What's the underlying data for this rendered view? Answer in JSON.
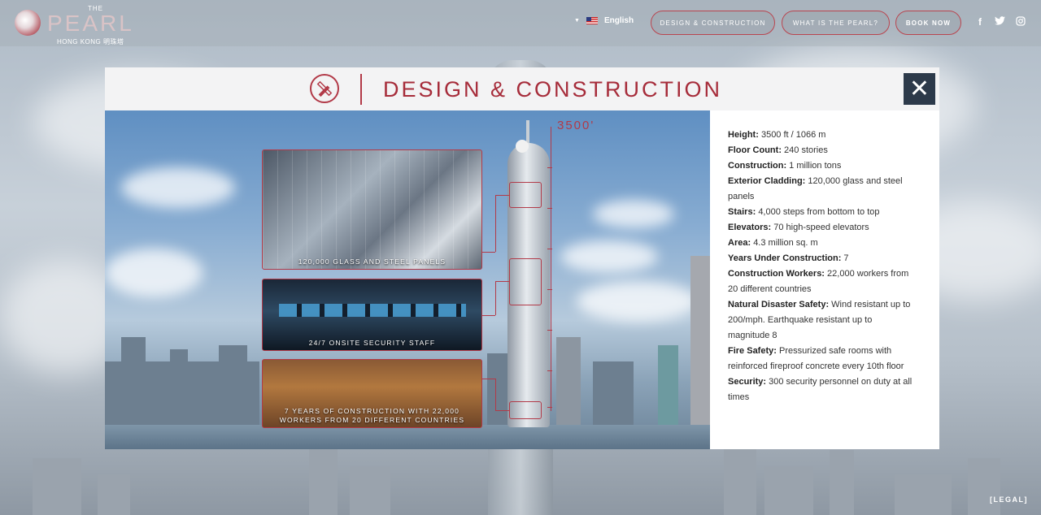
{
  "header": {
    "logo": {
      "the": "THE",
      "pearl": "PEARL",
      "subtitle": "HONG KONG 明珠塔"
    },
    "language": {
      "label": "English"
    },
    "nav": [
      {
        "label": "DESIGN & CONSTRUCTION"
      },
      {
        "label": "WHAT IS THE PEARL?"
      },
      {
        "label": "BOOK NOW"
      }
    ],
    "social": [
      "facebook-icon",
      "twitter-icon",
      "instagram-icon"
    ]
  },
  "modal": {
    "title": "DESIGN & CONSTRUCTION",
    "close_label": "✕",
    "height_label": "3500'",
    "panels": [
      {
        "caption": "120,000 GLASS AND STEEL PANELS"
      },
      {
        "caption": "24/7 ONSITE SECURITY STAFF"
      },
      {
        "caption": "7 YEARS OF CONSTRUCTION WITH 22,000 WORKERS FROM 20 DIFFERENT COUNTRIES"
      }
    ],
    "facts": [
      {
        "label": "Height:",
        "value": "3500 ft / 1066 m"
      },
      {
        "label": "Floor Count:",
        "value": "240 stories"
      },
      {
        "label": "Construction:",
        "value": "1 million tons"
      },
      {
        "label": "Exterior Cladding:",
        "value": "120,000 glass and steel panels"
      },
      {
        "label": "Stairs:",
        "value": "4,000 steps from bottom to top"
      },
      {
        "label": "Elevators:",
        "value": "70 high-speed elevators"
      },
      {
        "label": "Area:",
        "value": "4.3 million sq. m"
      },
      {
        "label": "Years Under Construction:",
        "value": "7"
      },
      {
        "label": "Construction Workers:",
        "value": "22,000 workers from 20 different countries"
      },
      {
        "label": "Natural Disaster Safety:",
        "value": "Wind resistant up to 200/mph. Earthquake resistant up to magnitude 8"
      },
      {
        "label": "Fire Safety:",
        "value": "Pressurized safe rooms with reinforced fireproof concrete every 10th floor"
      },
      {
        "label": "Security:",
        "value": "300 security personnel on duty at all times"
      }
    ]
  },
  "footer": {
    "legal": "[LEGAL]"
  },
  "colors": {
    "accent": "#b23a48",
    "close_bg": "#2d3a4a"
  }
}
